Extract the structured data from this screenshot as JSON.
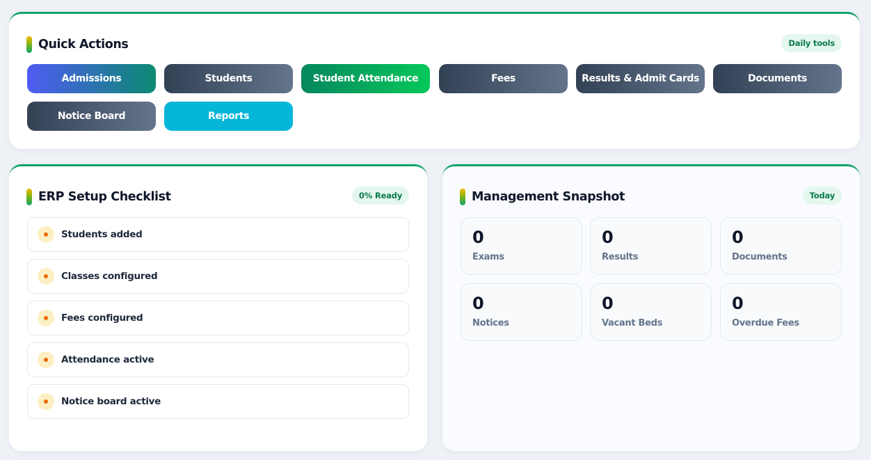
{
  "quick_actions": {
    "title": "Quick Actions",
    "badge": "Daily tools",
    "buttons": [
      {
        "label": "Admissions"
      },
      {
        "label": "Students"
      },
      {
        "label": "Student Attendance"
      },
      {
        "label": "Fees"
      },
      {
        "label": "Results & Admit Cards"
      },
      {
        "label": "Documents"
      },
      {
        "label": "Notice Board"
      },
      {
        "label": "Reports"
      }
    ]
  },
  "checklist": {
    "title": "ERP Setup Checklist",
    "badge": "0% Ready",
    "items": [
      {
        "label": "Students added",
        "status": "pending"
      },
      {
        "label": "Classes configured",
        "status": "pending"
      },
      {
        "label": "Fees configured",
        "status": "pending"
      },
      {
        "label": "Attendance active",
        "status": "pending"
      },
      {
        "label": "Notice board active",
        "status": "pending"
      }
    ]
  },
  "snapshot": {
    "title": "Management Snapshot",
    "badge": "Today",
    "stats": [
      {
        "value": "0",
        "label": "Exams"
      },
      {
        "value": "0",
        "label": "Results"
      },
      {
        "value": "0",
        "label": "Documents"
      },
      {
        "value": "0",
        "label": "Notices"
      },
      {
        "value": "0",
        "label": "Vacant Beds"
      },
      {
        "value": "0",
        "label": "Overdue Fees"
      }
    ]
  },
  "colors": {
    "accent_green": "#10a36b",
    "badge_bg": "#e4f7ee",
    "badge_text": "#0b7a4f",
    "pending_dot": "#ea6b0c"
  }
}
